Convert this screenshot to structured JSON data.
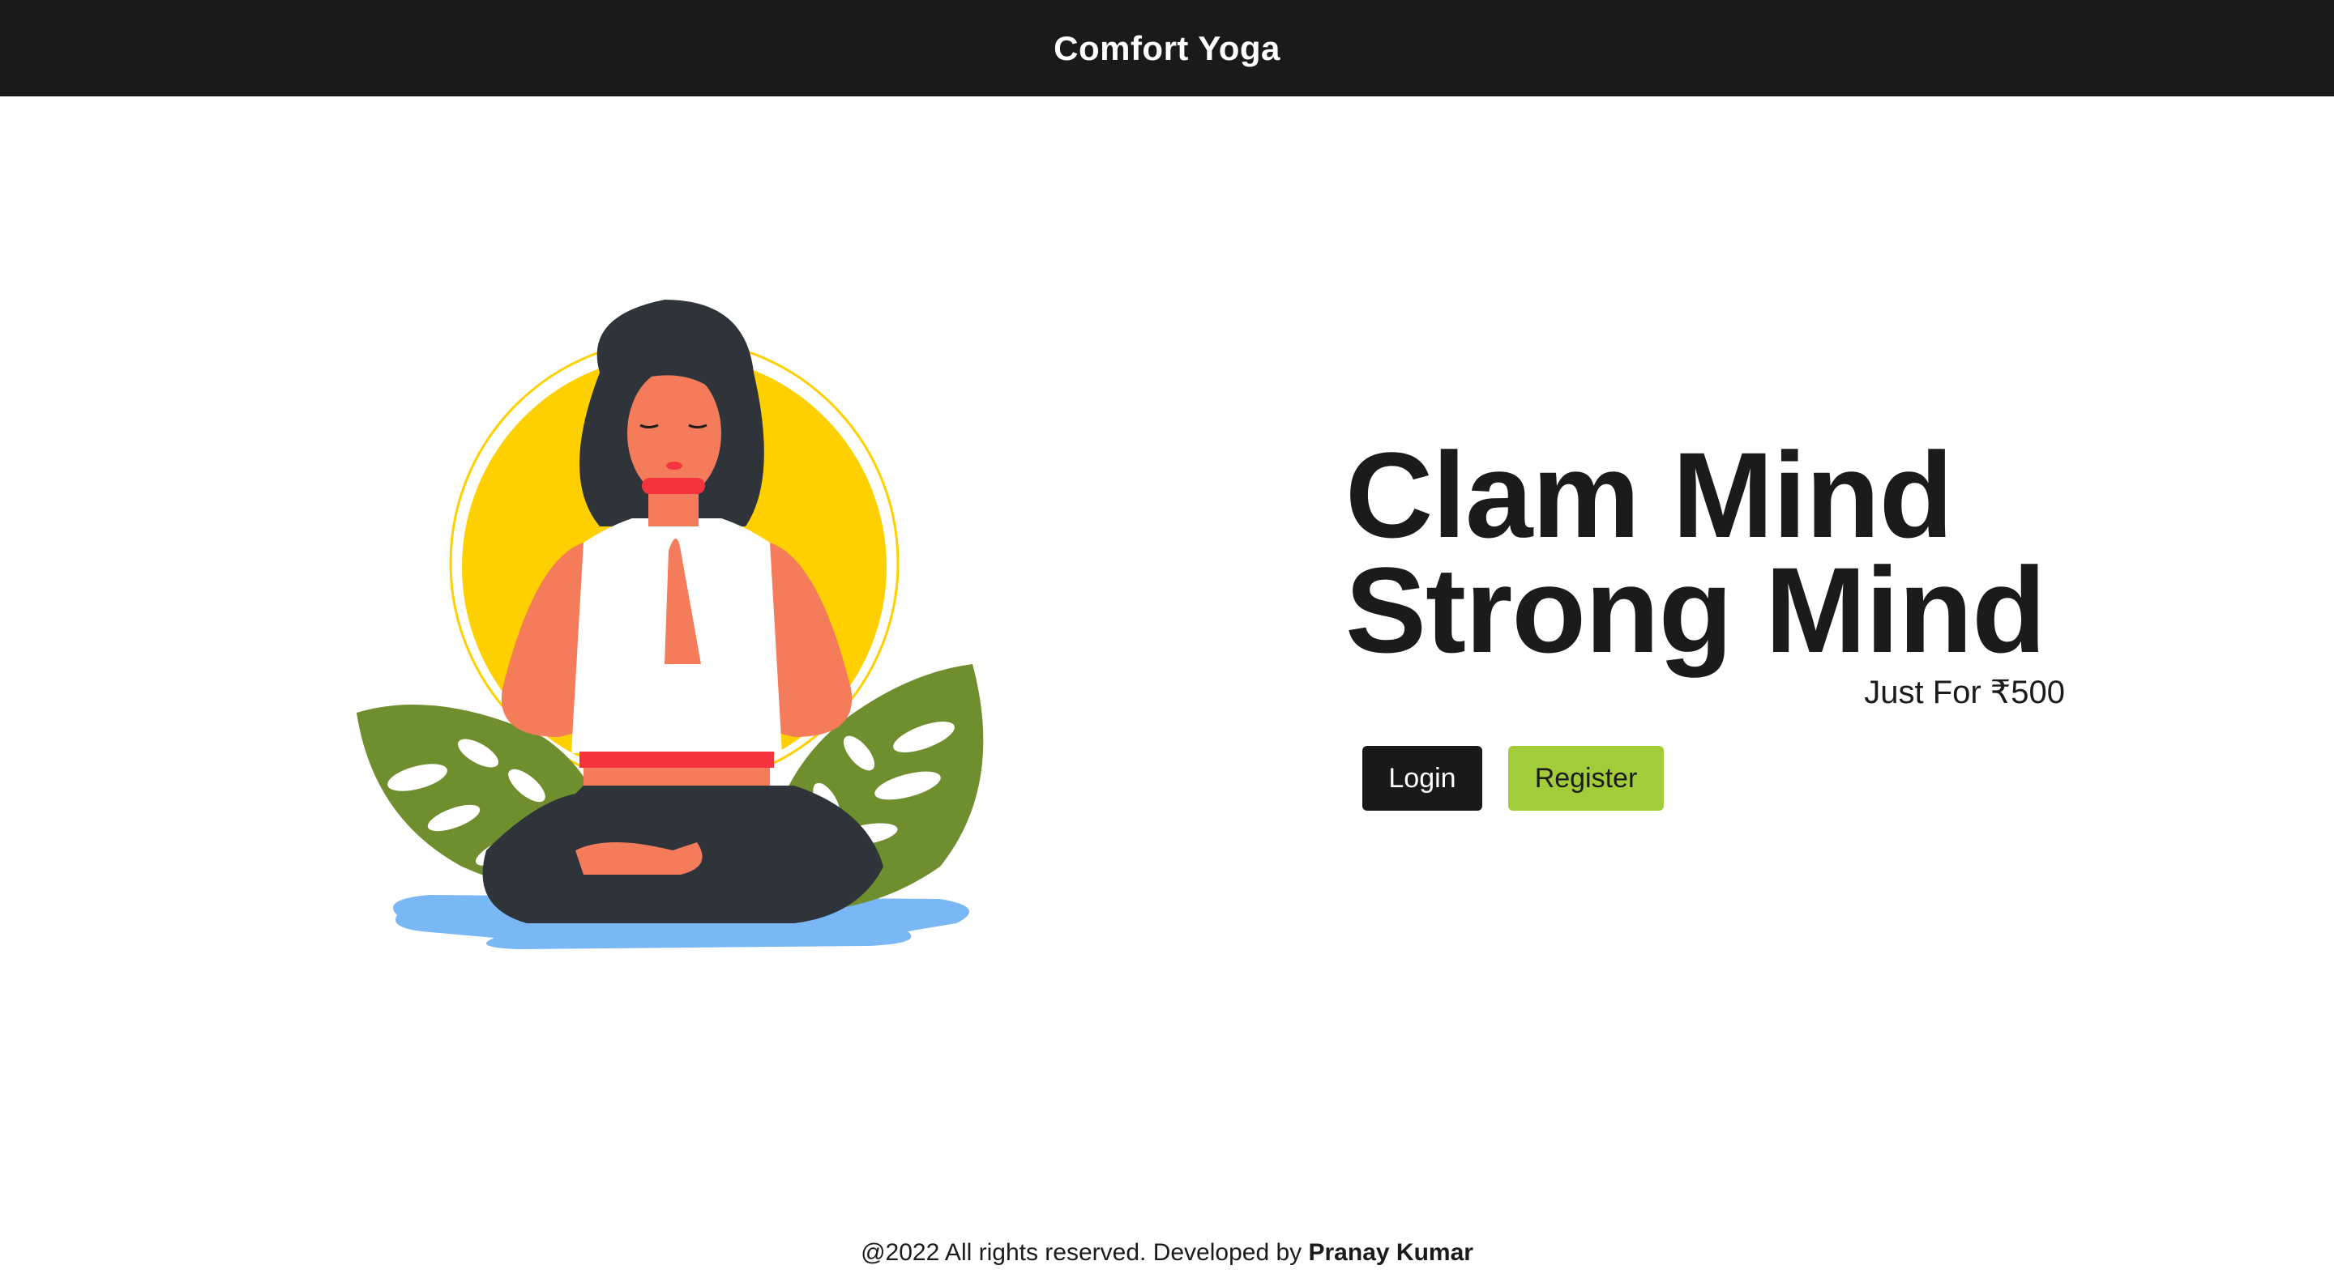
{
  "navbar": {
    "brand": "Comfort Yoga"
  },
  "hero": {
    "headline_line1": "Clam Mind",
    "headline_line2": "Strong Mind",
    "price_text": "Just For ₹500",
    "illustration": "woman-meditating-yoga-illustration"
  },
  "actions": {
    "login_label": "Login",
    "register_label": "Register"
  },
  "footer": {
    "text": "@2022 All rights reserved. Developed by",
    "author": "Pranay Kumar"
  },
  "colors": {
    "navbar_bg": "#1a1a1a",
    "login_bg": "#18191b",
    "register_bg": "#a3cc3a",
    "sun": "#ffd000",
    "leaf": "#6f8f2e",
    "water": "#7ab8f5",
    "skin": "#f47c5a",
    "hair_pants": "#2f343b"
  }
}
